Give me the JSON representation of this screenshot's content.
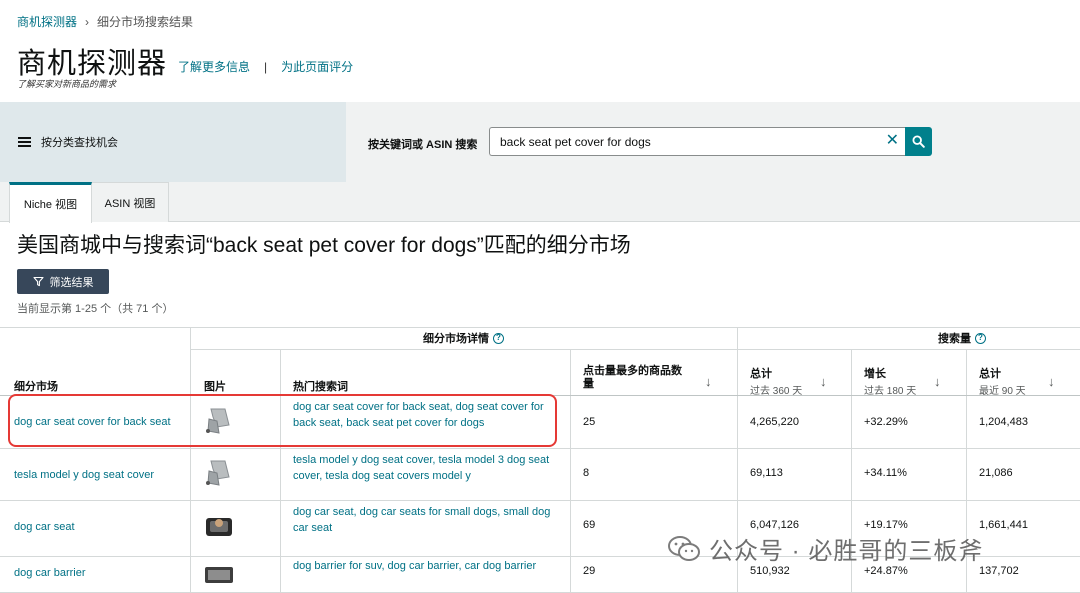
{
  "breadcrumb": {
    "root": "商机探测器",
    "current": "细分市场搜索结果"
  },
  "header": {
    "title": "商机探测器",
    "subtitle": "了解买家对新商品的需求",
    "learn_more": "了解更多信息",
    "divider": "|",
    "rate_page": "为此页面评分"
  },
  "search": {
    "category_label": "按分类查找机会",
    "keyword_label": "按关键词或 ASIN 搜索",
    "query": "back seat pet cover for dogs",
    "clear_glyph": "✕"
  },
  "tabs": [
    {
      "label": "Niche 视图",
      "active": true
    },
    {
      "label": "ASIN 视图",
      "active": false
    }
  ],
  "results": {
    "title": "美国商城中与搜索词“back seat pet cover for dogs”匹配的细分市场",
    "filter_label": "筛选结果",
    "count_text": "当前显示第 1-25 个（共 71 个）"
  },
  "table": {
    "group_details": "细分市场详情",
    "group_search_volume": "搜索量",
    "columns": {
      "niche": "细分市场",
      "image": "图片",
      "top_search_terms": "热门搜索词",
      "clicked_products_line1": "点击量最多的商品数",
      "clicked_products_line2": "量",
      "total_360": "总计",
      "total_360_sub": "过去 360 天",
      "growth_180": "增长",
      "growth_180_sub": "过去 180 天",
      "total_90": "总计",
      "total_90_sub": "最近 90 天"
    },
    "sort_glyph": "↓",
    "rows": [
      {
        "niche": "dog car seat cover for back seat",
        "terms": "dog car seat cover for back seat, dog seat cover for back seat, back seat pet cover for dogs",
        "clicked": "25",
        "total_360": "4,265,220",
        "growth_180": "+32.29%",
        "total_90": "1,204,483"
      },
      {
        "niche": "tesla model y dog seat cover",
        "terms": "tesla model y dog seat cover, tesla model 3 dog seat cover, tesla dog seat covers model y",
        "clicked": "8",
        "total_360": "69,113",
        "growth_180": "+34.11%",
        "total_90": "21,086"
      },
      {
        "niche": "dog car seat",
        "terms": "dog car seat, dog car seats for small dogs, small dog car seat",
        "clicked": "69",
        "total_360": "6,047,126",
        "growth_180": "+19.17%",
        "total_90": "1,661,441"
      },
      {
        "niche": "dog car barrier",
        "terms": "dog barrier for suv, dog car barrier, car dog barrier",
        "clicked": "29",
        "total_360": "510,932",
        "growth_180": "+24.87%",
        "total_90": "137,702"
      }
    ]
  },
  "watermark": {
    "text": "公众号 · 必胜哥的三板斧"
  },
  "colors": {
    "link": "#007185",
    "accent": "#00808c",
    "highlight": "#e53935",
    "filter_button": "#37475a"
  }
}
